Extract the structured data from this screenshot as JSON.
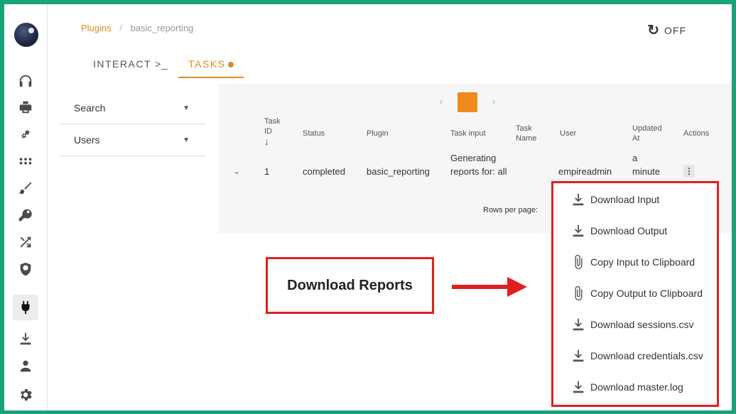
{
  "breadcrumb": {
    "link": "Plugins",
    "current": "basic_reporting"
  },
  "header": {
    "toggle_label": "OFF",
    "refresh_icon": "refresh-icon"
  },
  "tabs": [
    {
      "label": "INTERACT >_",
      "active": false
    },
    {
      "label": "TASKS",
      "active": true
    }
  ],
  "filters": [
    {
      "label": "Search"
    },
    {
      "label": "Users"
    }
  ],
  "sidebar": {
    "items": [
      {
        "icon": "headphones-icon"
      },
      {
        "icon": "printer-icon"
      },
      {
        "icon": "link-icon"
      },
      {
        "icon": "grid-icon"
      },
      {
        "icon": "brush-icon"
      },
      {
        "icon": "key-icon"
      },
      {
        "icon": "shuffle-icon"
      },
      {
        "icon": "shield-icon"
      },
      {
        "icon": "plug-icon",
        "active": true
      },
      {
        "icon": "download-icon"
      },
      {
        "icon": "user-icon"
      },
      {
        "icon": "gear-icon"
      }
    ]
  },
  "table": {
    "columns": {
      "task_id": "Task ID",
      "status": "Status",
      "plugin": "Plugin",
      "task_input": "Task input",
      "task_name": "Task Name",
      "user": "User",
      "updated_at": "Updated At",
      "actions": "Actions"
    },
    "row": {
      "task_id": "1",
      "status": "completed",
      "plugin": "basic_reporting",
      "task_input": "Generating reports for: all",
      "task_name": "",
      "user": "empireadmin",
      "updated_at": "a minute"
    },
    "rows_per_page_label": "Rows per page:"
  },
  "menu": {
    "items": [
      {
        "label": "Download Input",
        "icon": "download-icon"
      },
      {
        "label": "Download Output",
        "icon": "download-icon"
      },
      {
        "label": "Copy Input to Clipboard",
        "icon": "paperclip-icon"
      },
      {
        "label": "Copy Output to Clipboard",
        "icon": "paperclip-icon"
      },
      {
        "label": "Download sessions.csv",
        "icon": "download-icon"
      },
      {
        "label": "Download credentials.csv",
        "icon": "download-icon"
      },
      {
        "label": "Download master.log",
        "icon": "download-icon"
      }
    ]
  },
  "callout": {
    "label": "Download Reports"
  },
  "colors": {
    "accent": "#f08a1c",
    "highlight": "#e02020",
    "frame": "#1aa37a"
  }
}
